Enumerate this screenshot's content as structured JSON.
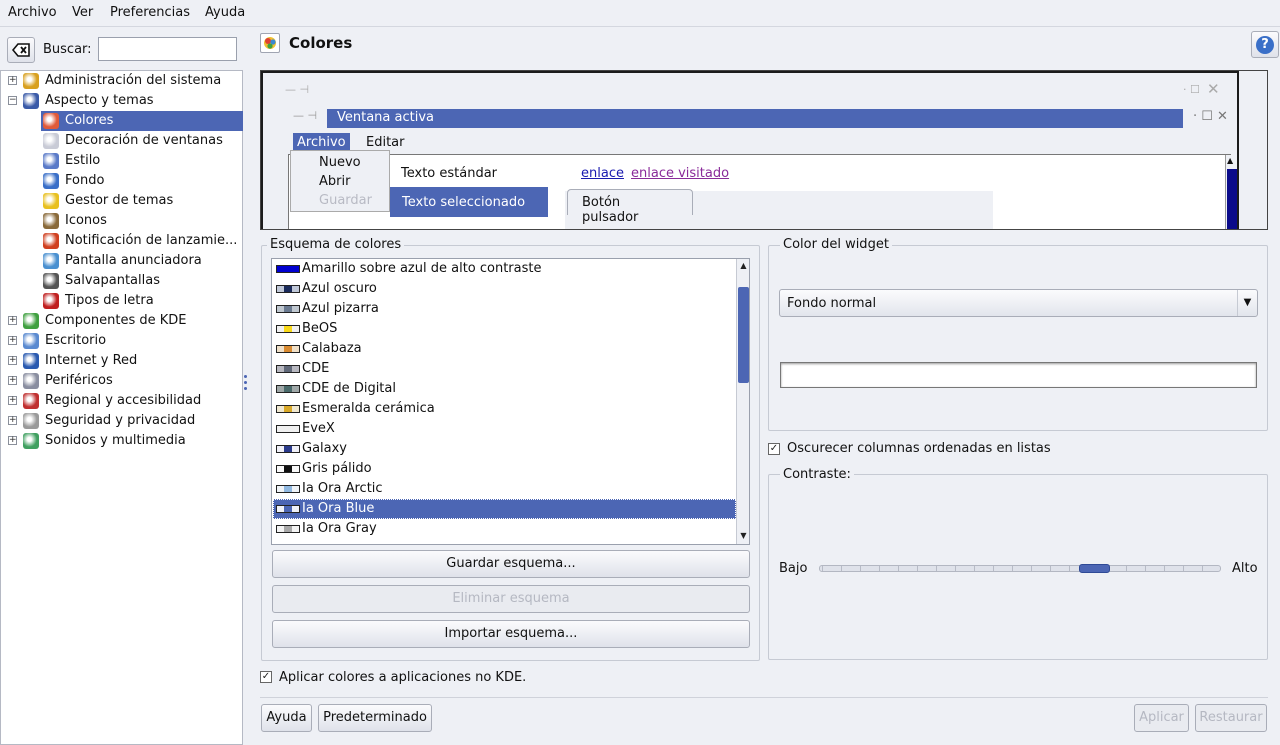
{
  "menubar": {
    "items": [
      {
        "label": "Archivo"
      },
      {
        "label": "Ver"
      },
      {
        "label": "Preferencias"
      },
      {
        "label": "Ayuda"
      }
    ]
  },
  "search": {
    "label": "Buscar:",
    "value": ""
  },
  "tree": {
    "items": [
      {
        "label": "Administración del sistema",
        "level": 0,
        "expander": "+",
        "icon": "admin-icon",
        "color": "#d8a020"
      },
      {
        "label": "Aspecto y temas",
        "level": 0,
        "expander": "−",
        "icon": "appearance-icon",
        "color": "#3a5aa8"
      },
      {
        "label": "Colores",
        "level": 1,
        "icon": "colors-icon",
        "color": "#e05a3a",
        "selected": true
      },
      {
        "label": "Decoración de ventanas",
        "level": 1,
        "icon": "window-decoration-icon",
        "color": "#c9cbd6"
      },
      {
        "label": "Estilo",
        "level": 1,
        "icon": "style-icon",
        "color": "#5a7ac8"
      },
      {
        "label": "Fondo",
        "level": 1,
        "icon": "background-icon",
        "color": "#3a6fc8"
      },
      {
        "label": "Gestor de temas",
        "level": 1,
        "icon": "theme-manager-icon",
        "color": "#e8c020"
      },
      {
        "label": "Iconos",
        "level": 1,
        "icon": "icons-icon",
        "color": "#8a6a3a"
      },
      {
        "label": "Notificación de lanzamie...",
        "level": 1,
        "icon": "launch-feedback-icon",
        "color": "#d04020"
      },
      {
        "label": "Pantalla anunciadora",
        "level": 1,
        "icon": "splash-screen-icon",
        "color": "#4a90d0"
      },
      {
        "label": "Salvapantallas",
        "level": 1,
        "icon": "screensaver-icon",
        "color": "#555555"
      },
      {
        "label": "Tipos de letra",
        "level": 1,
        "icon": "fonts-icon",
        "color": "#c02020"
      },
      {
        "label": "Componentes de KDE",
        "level": 0,
        "expander": "+",
        "icon": "kde-components-icon",
        "color": "#40a040"
      },
      {
        "label": "Escritorio",
        "level": 0,
        "expander": "+",
        "icon": "desktop-icon",
        "color": "#5a8ad0"
      },
      {
        "label": "Internet y Red",
        "level": 0,
        "expander": "+",
        "icon": "internet-icon",
        "color": "#2a5ab0"
      },
      {
        "label": "Periféricos",
        "level": 0,
        "expander": "+",
        "icon": "peripherals-icon",
        "color": "#8a8ea0"
      },
      {
        "label": "Regional y accesibilidad",
        "level": 0,
        "expander": "+",
        "icon": "regional-icon",
        "color": "#c03030"
      },
      {
        "label": "Seguridad y privacidad",
        "level": 0,
        "expander": "+",
        "icon": "security-icon",
        "color": "#9a9a9a"
      },
      {
        "label": "Sonidos y multimedia",
        "level": 0,
        "expander": "+",
        "icon": "sound-icon",
        "color": "#40a060"
      }
    ]
  },
  "header": {
    "title": "Colores",
    "help_icon": "help-icon"
  },
  "preview": {
    "active_window_title": "Ventana activa",
    "menu_archivo": "Archivo",
    "menu_editar": "Editar",
    "dropdown_items": [
      "Nuevo",
      "Abrir",
      "Guardar"
    ],
    "standard_text": "Texto estándar",
    "link": "enlace",
    "visited_link": "enlace visitado",
    "selected_text": "Texto seleccionado",
    "push_button": "Botón pulsador"
  },
  "scheme_group": {
    "title": "Esquema de colores",
    "schemes": [
      {
        "name": "Amarillo sobre azul de alto contraste",
        "colors": [
          "#0000d0",
          "#0000d0",
          "#0000d0"
        ]
      },
      {
        "name": "Azul oscuro",
        "colors": [
          "#c0c8d8",
          "#1a2a5a",
          "#c0c8d8"
        ]
      },
      {
        "name": "Azul pizarra",
        "colors": [
          "#c0c8d0",
          "#6a7a90",
          "#c0c8d0"
        ]
      },
      {
        "name": "BeOS",
        "colors": [
          "#f0f0f0",
          "#f8d818",
          "#f0f0f0"
        ]
      },
      {
        "name": "Calabaza",
        "colors": [
          "#f0e0c8",
          "#d88a30",
          "#f0e0c8"
        ]
      },
      {
        "name": "CDE",
        "colors": [
          "#b8b8c0",
          "#606878",
          "#b8b8c0"
        ]
      },
      {
        "name": "CDE de Digital",
        "colors": [
          "#a0a8a8",
          "#4a6a6a",
          "#a0a8a8"
        ]
      },
      {
        "name": "Esmeralda cerámica",
        "colors": [
          "#f0e8d0",
          "#d8a828",
          "#f0e8d0"
        ]
      },
      {
        "name": "EveX",
        "colors": [
          "#f0f0f0",
          "#f0f0f0",
          "#f0f0f0"
        ]
      },
      {
        "name": "Galaxy",
        "colors": [
          "#f0f0f8",
          "#2a3a8a",
          "#f0f0f8"
        ]
      },
      {
        "name": "Gris pálido",
        "colors": [
          "#f8f8f8",
          "#101010",
          "#f8f8f8"
        ]
      },
      {
        "name": "Ia Ora Arctic",
        "colors": [
          "#f0f4f8",
          "#90b8e0",
          "#f0f4f8"
        ]
      },
      {
        "name": "Ia Ora Blue",
        "colors": [
          "#f0f2f8",
          "#4c66b4",
          "#f0f2f8"
        ],
        "selected": true
      },
      {
        "name": "Ia Ora Gray",
        "colors": [
          "#f4f4f4",
          "#a8a8a8",
          "#f4f4f4"
        ]
      }
    ],
    "save_button": "Guardar esquema...",
    "delete_button": "Eliminar esquema",
    "import_button": "Importar esquema..."
  },
  "widget_group": {
    "title": "Color del widget",
    "selected_widget": "Fondo normal"
  },
  "options": {
    "shade_sorted": {
      "label": "Oscurecer columnas ordenadas en listas",
      "checked": true
    },
    "contrast": {
      "label": "Contraste:",
      "low": "Bajo",
      "high": "Alto",
      "value_fraction": 0.67
    },
    "apply_non_kde": {
      "label": "Aplicar colores a aplicaciones no KDE.",
      "checked": true
    }
  },
  "footer": {
    "help": "Ayuda",
    "defaults": "Predeterminado",
    "apply": "Aplicar",
    "reset": "Restaurar"
  },
  "colors": {
    "accent": "#4c66b4",
    "window_bg": "#eef0f5"
  }
}
